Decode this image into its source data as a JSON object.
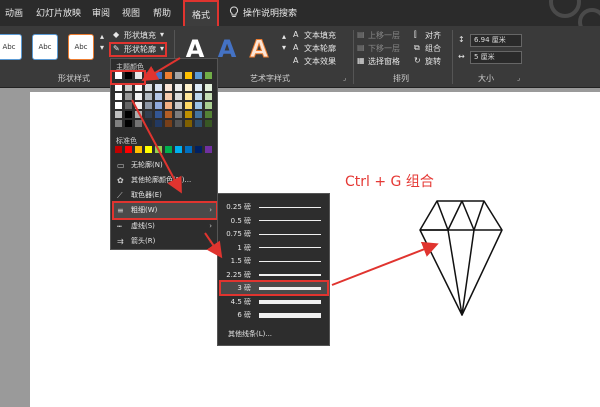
{
  "tabs": [
    {
      "label": "动画",
      "active": false
    },
    {
      "label": "幻灯片放映",
      "active": false
    },
    {
      "label": "审阅",
      "active": false
    },
    {
      "label": "视图",
      "active": false
    },
    {
      "label": "帮助",
      "active": false
    },
    {
      "label": "格式",
      "active": true
    }
  ],
  "tell_me": {
    "label": "操作说明搜索",
    "icon": "lightbulb-icon"
  },
  "ribbon": {
    "shape_styles": {
      "thumb_label": "Abc",
      "fill_label": "形状填充",
      "outline_label": "形状轮廓",
      "group_label": "形状样式"
    },
    "wordart": {
      "letter": "A",
      "text_fill": "文本填充",
      "text_outline": "文本轮廓",
      "text_effects": "文本效果",
      "group_label": "艺术字样式"
    },
    "arrange": {
      "bring_forward": "上移一层",
      "send_backward": "下移一层",
      "selection_pane": "选择窗格",
      "align": "对齐",
      "group": "组合",
      "rotate": "旋转",
      "group_label": "排列"
    },
    "size": {
      "height": "6.94 厘米",
      "width": "5 厘米",
      "group_label": "大小"
    }
  },
  "outline_menu": {
    "theme_colors_label": "主题颜色",
    "standard_colors_label": "标准色",
    "no_outline": "无轮廓(N)",
    "more_colors": "其他轮廓颜色(M)...",
    "eyedropper": "取色器(E)",
    "weight": "粗细(W)",
    "dashes": "虚线(S)",
    "arrows": "箭头(R)",
    "theme_colors": [
      "#ffffff",
      "#000000",
      "#e7e6e6",
      "#44546a",
      "#4472c4",
      "#ed7d31",
      "#a5a5a5",
      "#ffc000",
      "#5b9bd5",
      "#70ad47"
    ],
    "standard_colors": [
      "#c00000",
      "#ff0000",
      "#ffc000",
      "#ffff00",
      "#92d050",
      "#00b050",
      "#00b0f0",
      "#0070c0",
      "#002060",
      "#7030a0"
    ]
  },
  "weight_menu": {
    "options": [
      {
        "label": "0.25 磅",
        "pt": 0.25,
        "selected": false
      },
      {
        "label": "0.5 磅",
        "pt": 0.5,
        "selected": false
      },
      {
        "label": "0.75 磅",
        "pt": 0.75,
        "selected": false
      },
      {
        "label": "1 磅",
        "pt": 1,
        "selected": false
      },
      {
        "label": "1.5 磅",
        "pt": 1.5,
        "selected": false
      },
      {
        "label": "2.25 磅",
        "pt": 2.25,
        "selected": false
      },
      {
        "label": "3 磅",
        "pt": 3,
        "selected": true
      },
      {
        "label": "4.5 磅",
        "pt": 4.5,
        "selected": false
      },
      {
        "label": "6 磅",
        "pt": 6,
        "selected": false
      }
    ],
    "more_lines": "其他线条(L)..."
  },
  "slide": {
    "annotation": "Ctrl  +  G   组合",
    "accent": "#e53935"
  }
}
